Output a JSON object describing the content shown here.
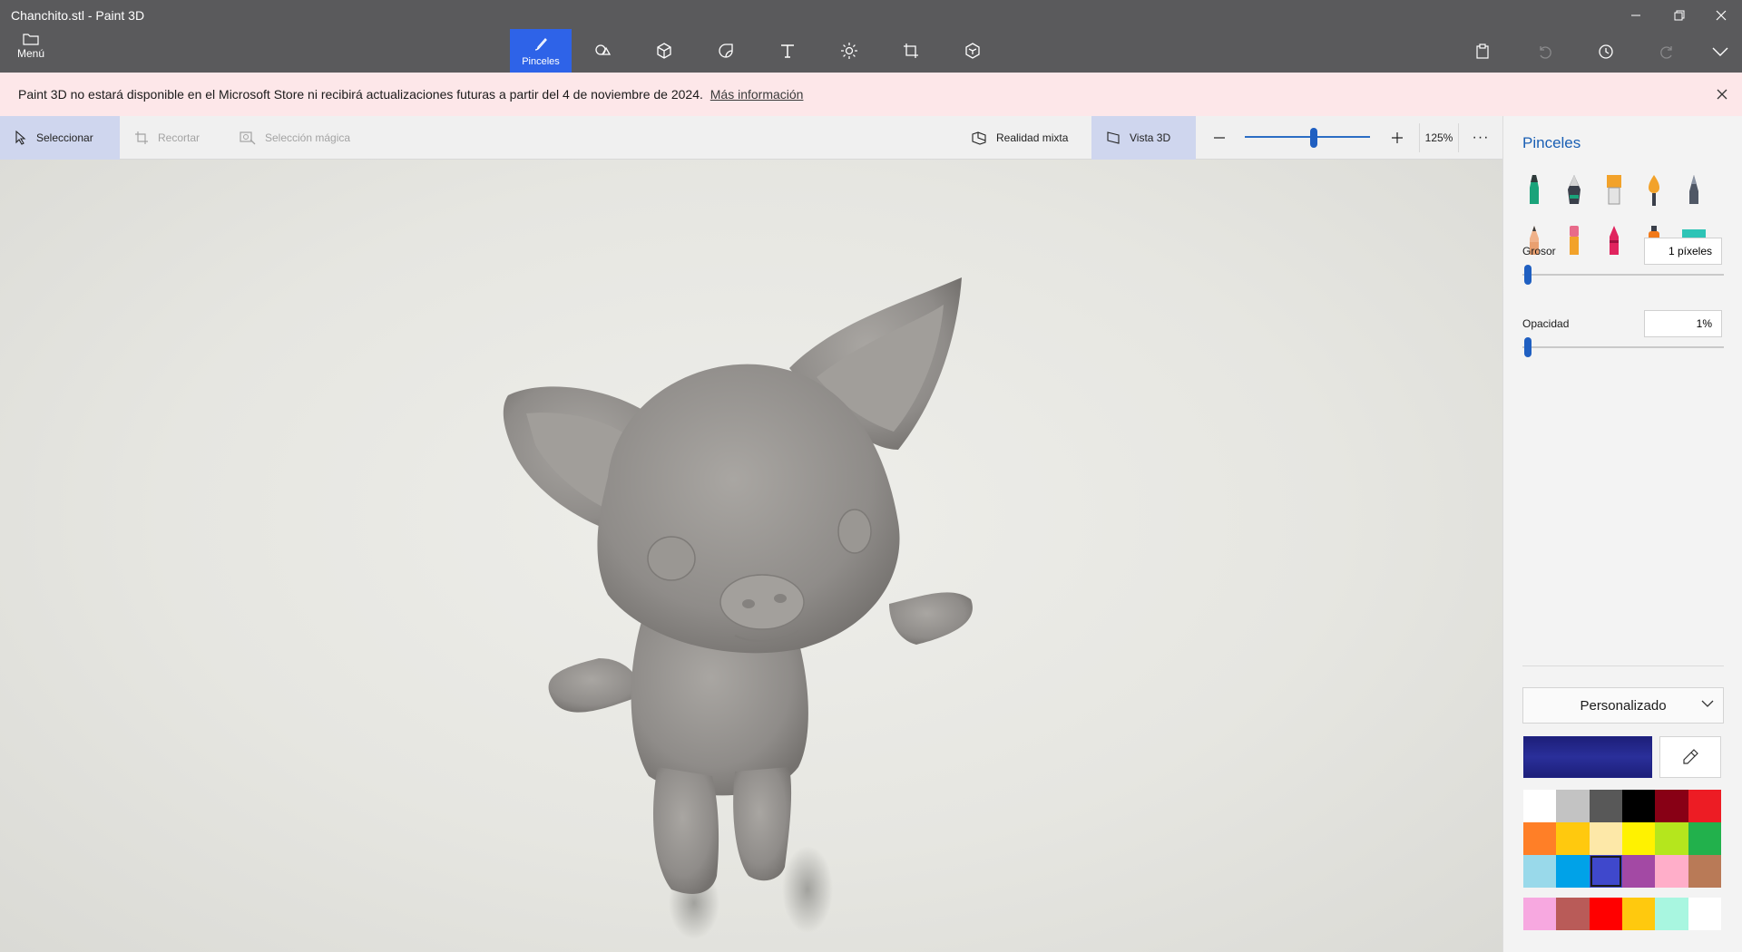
{
  "window": {
    "title": "Chanchito.stl - Paint 3D"
  },
  "window_controls": {
    "minimize_icon": "minimize-icon",
    "restore_icon": "restore-icon",
    "close_icon": "close-icon"
  },
  "menu": {
    "label": "Menú"
  },
  "ribbon": {
    "active_tool_label": "Pinceles",
    "tools": [
      "brush-icon",
      "shapes-2d-icon",
      "shapes-3d-icon",
      "stickers-icon",
      "text-icon",
      "effects-icon",
      "canvas-icon",
      "library-3d-icon"
    ]
  },
  "banner": {
    "text": "Paint 3D no estará disponible en el Microsoft Store ni recibirá actualizaciones futuras a partir del 4 de noviembre de 2024.",
    "link": "Más información"
  },
  "subbar": {
    "select": "Seleccionar",
    "crop": "Recortar",
    "magic_select": "Selección mágica",
    "mixed_reality": "Realidad mixta",
    "view_3d": "Vista 3D",
    "zoom": "125%",
    "zoom_level": 0.55,
    "more": "···"
  },
  "panel": {
    "title": "Pinceles",
    "brushes": [
      "marker-icon",
      "calligraphy-pen-icon",
      "oil-brush-icon",
      "watercolor-icon",
      "pixel-pen-icon",
      "pencil-icon",
      "eraser-icon",
      "crayon-icon",
      "spray-can-icon",
      "fill-icon"
    ],
    "thickness_label": "Grosor",
    "thickness_value": "1 píxeles",
    "thickness_level": 0.01,
    "opacity_label": "Opacidad",
    "opacity_value": "1%",
    "opacity_level": 0.01,
    "color_mode": "Personalizado",
    "current_color": "#1f2385",
    "palette": [
      "#ffffff",
      "#c3c3c3",
      "#585858",
      "#000000",
      "#880015",
      "#ed1c24",
      "#ff7f27",
      "#ffc90e",
      "#fde8a8",
      "#fff200",
      "#b5e61d",
      "#22b14c",
      "#99d9ea",
      "#00a2e8",
      "#3f48cc",
      "#a349a4",
      "#ffaec9",
      "#b97a57"
    ],
    "custom_palette": [
      "#f7a8e0",
      "#b95b58",
      "#ff0000",
      "#ffc90e",
      "#a8f6e0",
      "#ffffff"
    ],
    "selected_swatch_index": 14
  }
}
